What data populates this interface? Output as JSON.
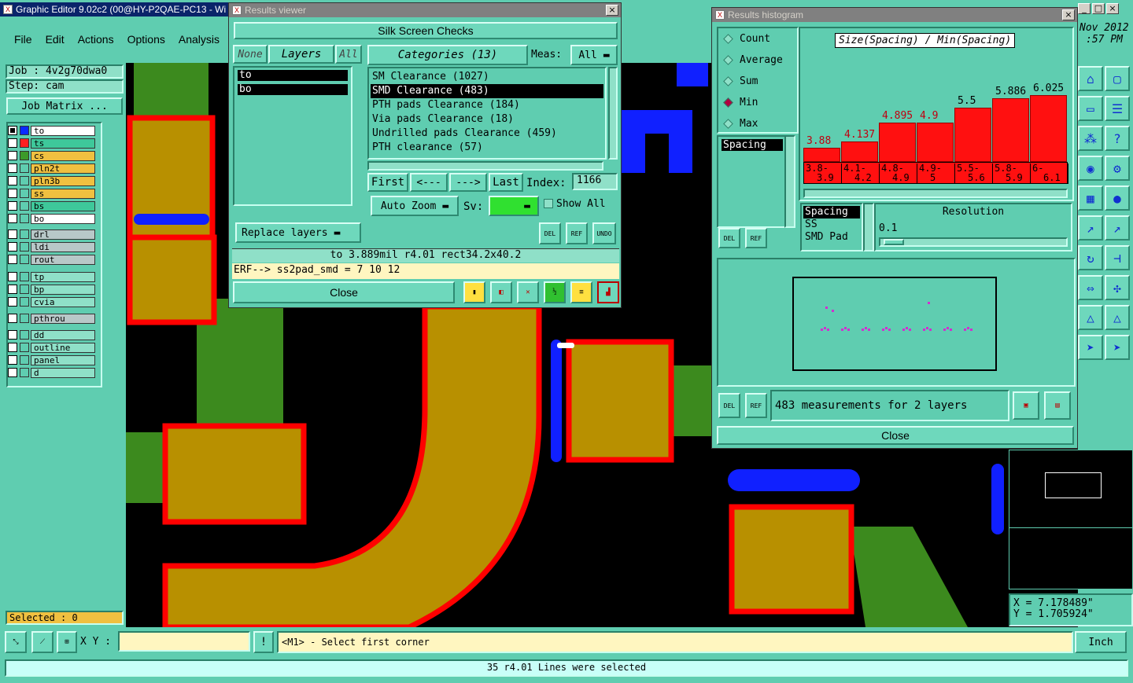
{
  "app": {
    "title": "Graphic Editor 9.02c2 (00@HY-P2QAE-PC13 - Wi",
    "menu": [
      "File",
      "Edit",
      "Actions",
      "Options",
      "Analysis"
    ],
    "date_partial": "Nov 2012",
    "time_partial": ":57 PM"
  },
  "job": {
    "job_label": "Job : 4v2g70dwa0",
    "step_label": "Step: cam",
    "matrix_button": "Job Matrix ..."
  },
  "layers": [
    {
      "name": "to",
      "color": "#ffffff",
      "swatch": "#0a2aff",
      "checked": true
    },
    {
      "name": "ts",
      "color": "#3ec89a",
      "swatch": "#ff2020",
      "checked": false
    },
    {
      "name": "cs",
      "color": "#f0c040",
      "swatch": "#3c9a2a",
      "checked": false
    },
    {
      "name": "pln2t",
      "color": "#f0c040",
      "swatch": "#5fcdb0",
      "checked": false
    },
    {
      "name": "pln3b",
      "color": "#f0c040",
      "swatch": "#5fcdb0",
      "checked": false
    },
    {
      "name": "ss",
      "color": "#f0c040",
      "swatch": "#5fcdb0",
      "checked": false
    },
    {
      "name": "bs",
      "color": "#3ec89a",
      "swatch": "#5fcdb0",
      "checked": false
    },
    {
      "name": "bo",
      "color": "#ffffff",
      "swatch": "#5fcdb0",
      "checked": false
    },
    {
      "name": "drl",
      "color": "#b8c8c8",
      "swatch": "#5fcdb0",
      "checked": false
    },
    {
      "name": "ldi",
      "color": "#b8c8c8",
      "swatch": "#5fcdb0",
      "checked": false
    },
    {
      "name": "rout",
      "color": "#b8c8c8",
      "swatch": "#5fcdb0",
      "checked": false
    },
    {
      "name": "tp",
      "color": "#8fe0c8",
      "swatch": "#5fcdb0",
      "checked": false
    },
    {
      "name": "bp",
      "color": "#8fe0c8",
      "swatch": "#5fcdb0",
      "checked": false
    },
    {
      "name": "cvia",
      "color": "#8fe0c8",
      "swatch": "#5fcdb0",
      "checked": false
    },
    {
      "name": "pthrou",
      "color": "#b8c8c8",
      "swatch": "#5fcdb0",
      "checked": false
    },
    {
      "name": "dd",
      "color": "#8fe0c8",
      "swatch": "#5fcdb0",
      "checked": false
    },
    {
      "name": "outline",
      "color": "#8fe0c8",
      "swatch": "#5fcdb0",
      "checked": false
    },
    {
      "name": "panel",
      "color": "#8fe0c8",
      "swatch": "#5fcdb0",
      "checked": false
    },
    {
      "name": "d",
      "color": "#8fe0c8",
      "swatch": "#5fcdb0",
      "checked": false
    }
  ],
  "selected_label": "Selected : 0",
  "results_viewer": {
    "title": "Results viewer",
    "header": "Silk Screen Checks",
    "btn_none": "None",
    "btn_layers": "Layers",
    "btn_all": "All",
    "layer_list": [
      "to",
      "bo"
    ],
    "categories_btn": "Categories (13)",
    "meas_label": "Meas:",
    "meas_value": "All",
    "categories": [
      "SM Clearance (1027)",
      "SMD Clearance (483)",
      "PTH pads Clearance (184)",
      "Via pads Clearance (18)",
      "Undrilled pads Clearance (459)",
      "PTH clearance (57)"
    ],
    "first": "First",
    "prev": "<---",
    "next": "--->",
    "last": "Last",
    "index_label": "Index:",
    "index_value": "1166",
    "auto_zoom": "Auto Zoom",
    "sv_label": "Sv:",
    "show_all": "Show All",
    "replace_layers": "Replace layers",
    "del": "DEL",
    "ref": "REF",
    "undo": "UNDO",
    "status": "to 3.889mil  r4.01  rect34.2x40.2",
    "erf": "ERF--> ss2pad_smd = 7 10 12",
    "close": "Close"
  },
  "histogram": {
    "title": "Results histogram",
    "modes": [
      "Count",
      "Average",
      "Sum",
      "Min",
      "Max"
    ],
    "selected_mode": "Min",
    "param_list": [
      "Spacing"
    ],
    "chart_title": "Size(Spacing) / Min(Spacing)",
    "resolution_label": "Resolution",
    "resolution_value": "0.1",
    "attr_list": [
      "Spacing",
      "SS",
      "SMD Pad"
    ],
    "del": "DEL",
    "ref": "REF",
    "summary": "483 measurements for 2 layers",
    "close": "Close"
  },
  "chart_data": {
    "type": "bar",
    "title": "Size(Spacing) / Min(Spacing)",
    "categories": [
      "3.8-3.9",
      "4.1-4.2",
      "4.8-4.9",
      "4.9-5",
      "5.5-5.6",
      "5.8-5.9",
      "6-6.1"
    ],
    "values": [
      3.88,
      4.137,
      4.895,
      4.9,
      5.5,
      5.886,
      6.025
    ],
    "labels": [
      "3.88",
      "4.137",
      "4.895",
      "4.9",
      "5.5",
      "5.886",
      "6.025"
    ],
    "bin_labels_line1": [
      "3.8-",
      "4.1-",
      "4.8-",
      "4.9-",
      "5.5-",
      "5.8-",
      "6-"
    ],
    "bin_labels_line2": [
      "3.9",
      "4.2",
      "4.9",
      "5",
      "5.6",
      "5.9",
      "6.1"
    ],
    "ylim": [
      0,
      6.5
    ],
    "bar_color": "#ff1010"
  },
  "coords": {
    "x": "X = 7.178489\"",
    "y": "Y = 1.705924\""
  },
  "bottom": {
    "xy_label": "X Y :",
    "xy_value": "",
    "prompt": "<M1> - Select first corner",
    "units": "Inch",
    "status": "35 r4.01 Lines were selected"
  }
}
